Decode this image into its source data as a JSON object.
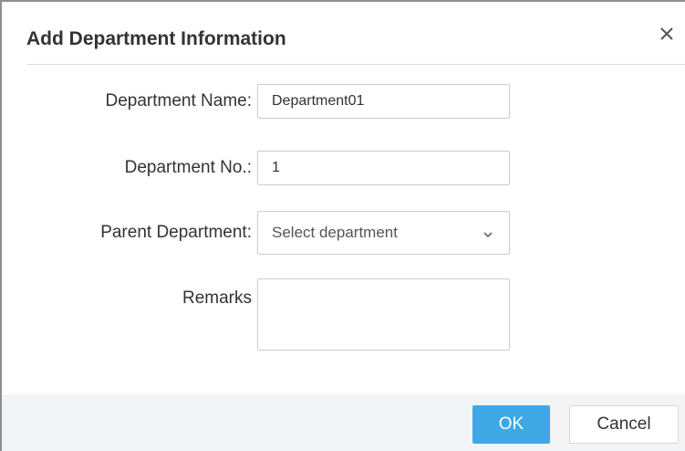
{
  "dialog": {
    "title": "Add Department Information",
    "close_icon": "close-icon"
  },
  "form": {
    "department_name": {
      "label": "Department Name:",
      "value": "Department01"
    },
    "department_no": {
      "label": "Department No.:",
      "value": "1"
    },
    "parent_department": {
      "label": "Parent Department:",
      "selected": "Select department",
      "icon": "chevron-down-icon"
    },
    "remarks": {
      "label": "Remarks",
      "value": ""
    }
  },
  "footer": {
    "ok_label": "OK",
    "cancel_label": "Cancel"
  },
  "colors": {
    "primary_button": "#3fa8e4",
    "footer_background": "#f2f4f6",
    "border": "#cccccc"
  }
}
